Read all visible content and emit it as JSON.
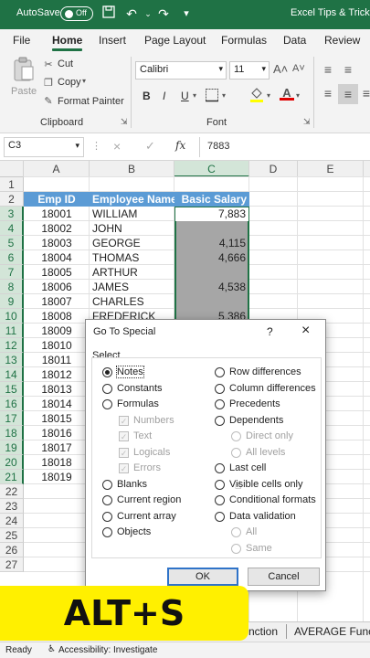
{
  "titlebar": {
    "autosave": "AutoSave",
    "toggle": "Off",
    "doc_title": "Excel Tips & Tricks"
  },
  "tabs": [
    "File",
    "Home",
    "Insert",
    "Page Layout",
    "Formulas",
    "Data",
    "Review"
  ],
  "active_tab": "Home",
  "ribbon": {
    "paste": "Paste",
    "cut": "Cut",
    "copy": "Copy",
    "format_painter": "Format Painter",
    "clipboard": "Clipboard",
    "font_name": "Calibri",
    "font_size": "11",
    "font": "Font",
    "bold": "B",
    "italic": "I",
    "underline": "U"
  },
  "formula_bar": {
    "name_box": "C3",
    "fx": "fx",
    "value": "7883"
  },
  "columns": [
    "A",
    "B",
    "C",
    "D",
    "E"
  ],
  "headers": {
    "a": "Emp ID",
    "b": "Employee Name",
    "c": "Basic Salary"
  },
  "rows": [
    {
      "id": "18001",
      "name": "WILLIAM",
      "salary": "7,883"
    },
    {
      "id": "18002",
      "name": "JOHN",
      "salary": ""
    },
    {
      "id": "18003",
      "name": "GEORGE",
      "salary": "4,115"
    },
    {
      "id": "18004",
      "name": "THOMAS",
      "salary": "4,666"
    },
    {
      "id": "18005",
      "name": "ARTHUR",
      "salary": ""
    },
    {
      "id": "18006",
      "name": "JAMES",
      "salary": "4,538"
    },
    {
      "id": "18007",
      "name": "CHARLES",
      "salary": ""
    },
    {
      "id": "18008",
      "name": "FREDERICK",
      "salary": "5,386"
    },
    {
      "id": "18009",
      "name": "",
      "salary": ""
    },
    {
      "id": "18010",
      "name": "",
      "salary": ""
    },
    {
      "id": "18011",
      "name": "",
      "salary": ""
    },
    {
      "id": "18012",
      "name": "",
      "salary": ""
    },
    {
      "id": "18013",
      "name": "",
      "salary": ""
    },
    {
      "id": "18014",
      "name": "",
      "salary": ""
    },
    {
      "id": "18015",
      "name": "",
      "salary": ""
    },
    {
      "id": "18016",
      "name": "",
      "salary": ""
    },
    {
      "id": "18017",
      "name": "",
      "salary": ""
    },
    {
      "id": "18018",
      "name": "",
      "salary": ""
    },
    {
      "id": "18019",
      "name": "",
      "salary": ""
    }
  ],
  "row_numbers": [
    "1",
    "2",
    "3",
    "4",
    "5",
    "6",
    "7",
    "8",
    "9",
    "10",
    "11",
    "12",
    "13",
    "14",
    "15",
    "16",
    "17",
    "18",
    "19",
    "20",
    "21",
    "22",
    "23",
    "24",
    "25",
    "26",
    "27"
  ],
  "dialog": {
    "title": "Go To Special",
    "help": "?",
    "close": "×",
    "select_label": "Select",
    "left_options": [
      {
        "label": "Notes",
        "state": "on"
      },
      {
        "label": "Constants",
        "state": "off"
      },
      {
        "label": "Formulas",
        "state": "off"
      },
      {
        "label": "Numbers",
        "state": "chk"
      },
      {
        "label": "Text",
        "state": "chk"
      },
      {
        "label": "Logicals",
        "state": "chk"
      },
      {
        "label": "Errors",
        "state": "chk"
      },
      {
        "label": "Blanks",
        "state": "off"
      },
      {
        "label": "Current region",
        "state": "off"
      },
      {
        "label": "Current array",
        "state": "off"
      },
      {
        "label": "Objects",
        "state": "off"
      }
    ],
    "right_options": [
      {
        "label": "Row differences",
        "state": "off"
      },
      {
        "label": "Column differences",
        "state": "off"
      },
      {
        "label": "Precedents",
        "state": "off"
      },
      {
        "label": "Dependents",
        "state": "off"
      },
      {
        "label": "Direct only",
        "state": "dis"
      },
      {
        "label": "All levels",
        "state": "dis"
      },
      {
        "label": "Last cell",
        "state": "off"
      },
      {
        "label": "Visible cells only",
        "state": "off"
      },
      {
        "label": "Conditional formats",
        "state": "off"
      },
      {
        "label": "Data validation",
        "state": "off"
      },
      {
        "label": "All",
        "state": "dis"
      },
      {
        "label": "Same",
        "state": "dis"
      }
    ],
    "ok": "OK",
    "cancel": "Cancel"
  },
  "sheet_tabs": [
    "nction",
    "AVERAGE Func"
  ],
  "status": {
    "ready": "Ready",
    "accessibility": "Accessibility: Investigate"
  },
  "overlay_text": "ALT+S",
  "colors": {
    "excel_green": "#1f7245",
    "header_blue": "#5b9bd5",
    "overlay_yellow": "#fff000"
  }
}
